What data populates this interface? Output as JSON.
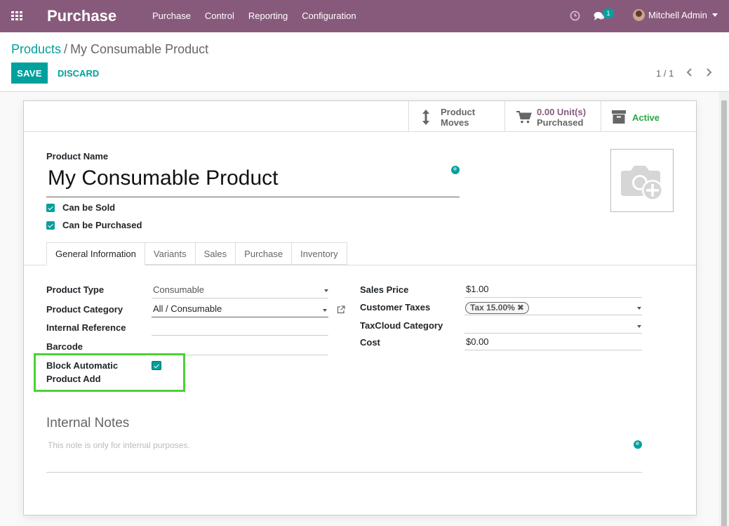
{
  "navbar": {
    "app_name": "Purchase",
    "menu": [
      "Purchase",
      "Control",
      "Reporting",
      "Configuration"
    ],
    "chat_badge": "1",
    "user_name": "Mitchell Admin",
    "bg_color": "#875a7b"
  },
  "breadcrumb": {
    "parent": "Products",
    "separator": "/",
    "current": "My Consumable Product"
  },
  "actions": {
    "save_label": "SAVE",
    "discard_label": "DISCARD"
  },
  "pager": {
    "text": "1 / 1"
  },
  "smart_buttons": {
    "moves": {
      "line1": "Product",
      "line2": "Moves"
    },
    "purchased": {
      "value": "0.00 Unit(s)",
      "label": "Purchased"
    },
    "active": {
      "label": "Active"
    }
  },
  "product": {
    "name_label": "Product Name",
    "name": "My Consumable Product",
    "can_be_sold": {
      "label": "Can be Sold",
      "checked": true
    },
    "can_be_purchased": {
      "label": "Can be Purchased",
      "checked": true
    }
  },
  "tabs": [
    "General Information",
    "Variants",
    "Sales",
    "Purchase",
    "Inventory"
  ],
  "general": {
    "left": {
      "product_type": {
        "label": "Product Type",
        "value": "Consumable"
      },
      "product_category": {
        "label": "Product Category",
        "value": "All / Consumable"
      },
      "internal_reference": {
        "label": "Internal Reference",
        "value": ""
      },
      "barcode": {
        "label": "Barcode",
        "value": ""
      },
      "block_auto_add": {
        "label_line1": "Block Automatic",
        "label_line2": "Product Add",
        "checked": true
      }
    },
    "right": {
      "sales_price": {
        "label": "Sales Price",
        "value": "$1.00"
      },
      "customer_taxes": {
        "label": "Customer Taxes",
        "tag": "Tax 15.00%",
        "remove": "✖"
      },
      "taxcloud_category": {
        "label": "TaxCloud Category",
        "value": ""
      },
      "cost": {
        "label": "Cost",
        "value": "$0.00"
      }
    }
  },
  "notes": {
    "title": "Internal Notes",
    "placeholder": "This note is only for internal purposes."
  },
  "colors": {
    "primary": "#00a09d",
    "brand": "#875a7b",
    "active": "#28a745",
    "highlight": "#4cd137"
  }
}
